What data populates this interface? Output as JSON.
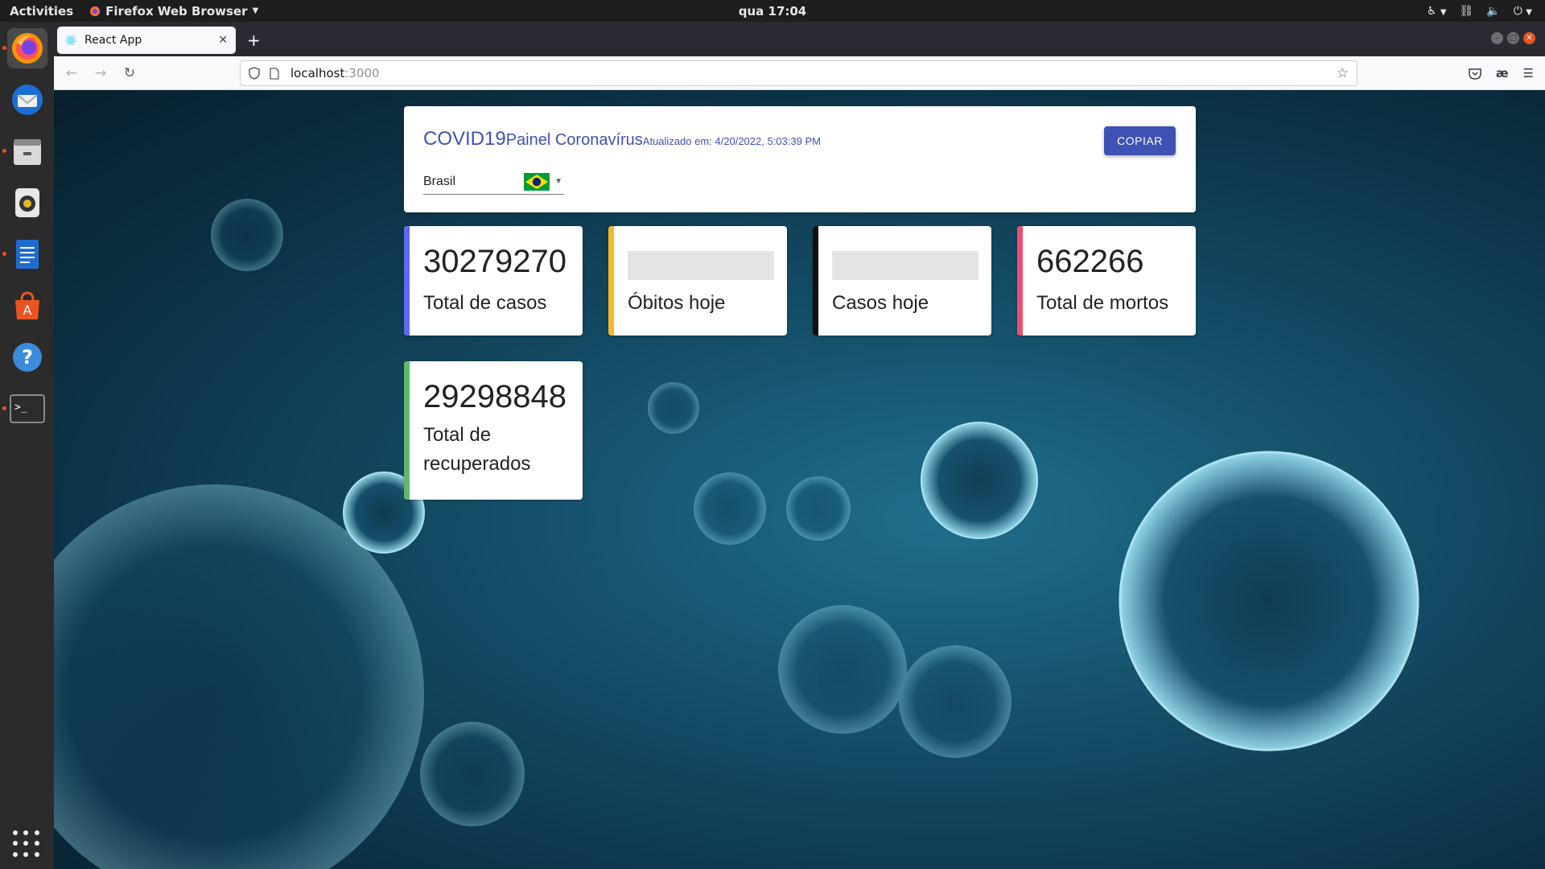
{
  "system": {
    "activities": "Activities",
    "app_menu": "Firefox Web Browser",
    "clock": "qua 17:04"
  },
  "dock": {
    "items": [
      "firefox-icon",
      "thunderbird-icon",
      "files-icon",
      "rhythmbox-icon",
      "writer-icon",
      "software-icon",
      "help-icon",
      "terminal-icon"
    ]
  },
  "browser": {
    "tab_title": "React App",
    "url_host": "localhost",
    "url_port": ":3000"
  },
  "dashboard": {
    "title": "COVID19",
    "subtitle": "Painel Coronavírus",
    "updated": "Atualizado em: 4/20/2022, 5:03:39 PM",
    "copy_label": "COPIAR",
    "country": "Brasil",
    "cards": [
      {
        "value": "30279270",
        "label": "Total de casos",
        "color": "#5c6bf3"
      },
      {
        "value": "",
        "label": "Óbitos hoje",
        "color": "#f6b72a"
      },
      {
        "value": "",
        "label": "Casos hoje",
        "color": "#111111"
      },
      {
        "value": "662266",
        "label": "Total de mortos",
        "color": "#ec4d73"
      },
      {
        "value": "29298848",
        "label": "Total de recuperados",
        "color": "#5cb96a"
      }
    ]
  },
  "colors": {
    "accent": "#3f51b5",
    "ubuntu_orange": "#e95420"
  }
}
